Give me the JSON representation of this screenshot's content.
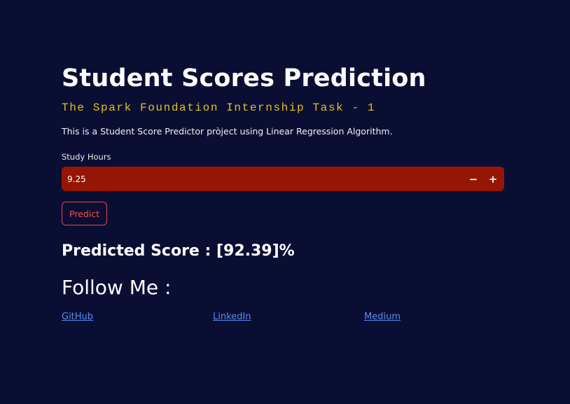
{
  "app": {
    "title": "Student Scores Prediction",
    "subtitle": "The Spark Foundation Internship Task - 1",
    "description": "This is a Student Score Predictor pròject using Linear Regression Algorithm."
  },
  "form": {
    "study_hours_label": "Study Hours",
    "study_hours_value": "9.25",
    "decrement_symbol": "−",
    "increment_symbol": "+",
    "predict_label": "Predict"
  },
  "result": {
    "text": "Predicted Score : [92.39]%"
  },
  "social": {
    "heading": "Follow Me :",
    "links": [
      {
        "label": "GitHub"
      },
      {
        "label": "LinkedIn"
      },
      {
        "label": "Medium"
      }
    ]
  },
  "colors": {
    "background": "#0b0e33",
    "subtitle": "#e0c224",
    "input_background": "#951604",
    "button_border": "#e8474f",
    "link": "#5a8cf0"
  }
}
